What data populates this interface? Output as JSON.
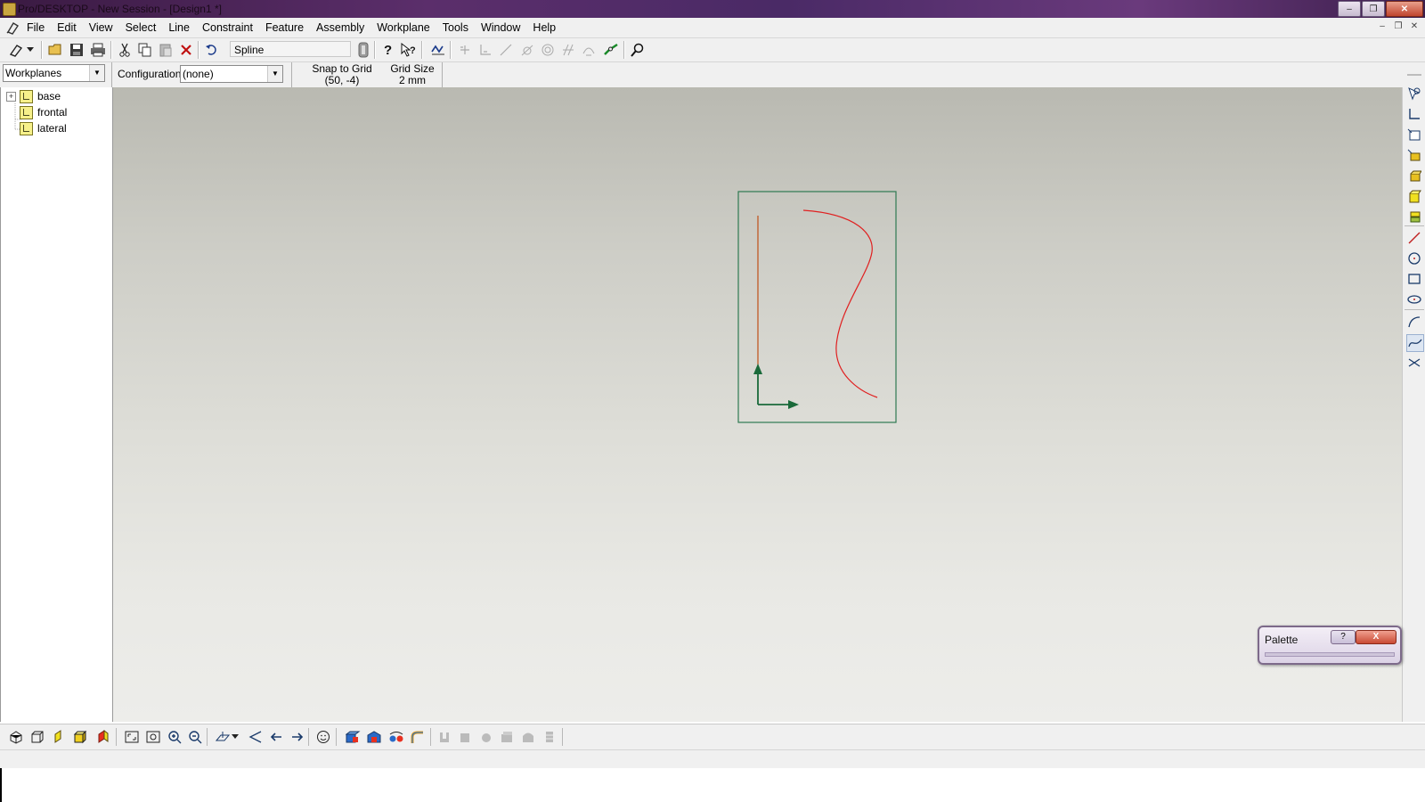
{
  "window": {
    "title": "Pro/DESKTOP - New Session - [Design1 *]"
  },
  "menu": {
    "items": [
      "File",
      "Edit",
      "View",
      "Select",
      "Line",
      "Constraint",
      "Feature",
      "Assembly",
      "Workplane",
      "Tools",
      "Window",
      "Help"
    ]
  },
  "toolbar": {
    "command_field": "Spline"
  },
  "bar2": {
    "browser_select": "Workplanes",
    "configuration_label": "Configuration:",
    "configuration_value": "(none)",
    "snap_label": "Snap to Grid",
    "snap_value": "(50, -4)",
    "grid_label": "Grid Size",
    "grid_value": "2 mm"
  },
  "tree": {
    "items": [
      {
        "label": "base",
        "expandable": true
      },
      {
        "label": "frontal",
        "expandable": false
      },
      {
        "label": "lateral",
        "expandable": false
      }
    ]
  },
  "palette": {
    "title": "Palette",
    "help": "?",
    "close": "X"
  },
  "colors": {
    "frame": "#2f7a52",
    "line": "#c05018",
    "spline": "#e02020",
    "axis": "#1a6a3a"
  }
}
